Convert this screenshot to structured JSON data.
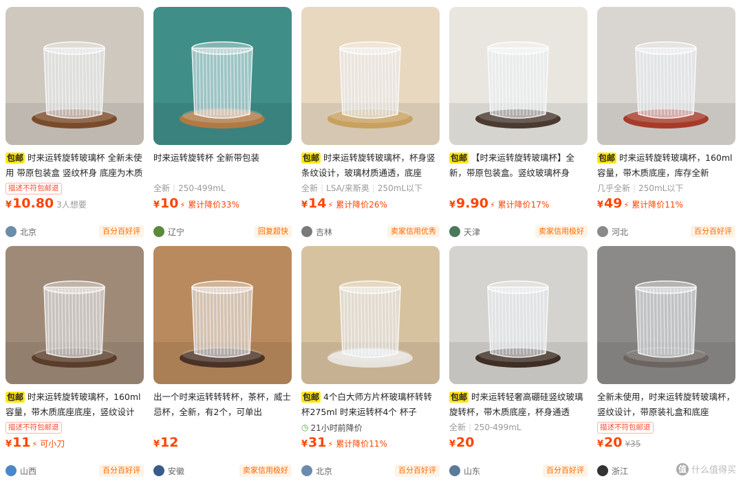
{
  "products": [
    {
      "free_shipping": "包邮",
      "title": "时来运转旋转玻璃杯 全新未使用 带原包装盒 竖纹杯身 底座为木质",
      "tag": "描述不符包邮退",
      "price": "10.80",
      "price_note": "3人想要",
      "location": "北京",
      "badge": "百分百好评",
      "bg_color": "#cfc8bf"
    },
    {
      "free_shipping": "",
      "title": "时来运转旋转杯 全新带包装",
      "meta": [
        "全新",
        "250-499mL"
      ],
      "price": "10",
      "price_note": "累计降价33%",
      "location": "辽宁",
      "badge": "回复超快",
      "bg_color": "#3f8e88"
    },
    {
      "free_shipping": "包邮",
      "title": "时来运转旋转玻璃杯，杯身竖条纹设计，玻璃材质通透，底座",
      "meta": [
        "全新",
        "LSA/来斯奥",
        "250mL以下"
      ],
      "price": "14",
      "price_note": "累计降价26%",
      "location": "吉林",
      "badge": "卖家信用优秀",
      "bg_color": "#e8d8c0"
    },
    {
      "free_shipping": "包邮",
      "title": "【时来运转旋转玻璃杯】全新，带原包装盒。竖纹玻璃杯身",
      "price": "9.90",
      "price_note": "累计降价17%",
      "location": "天津",
      "badge": "卖家信用极好",
      "bg_color": "#e9e6e0"
    },
    {
      "free_shipping": "包邮",
      "title": "时来运转旋转玻璃杯，160ml容量，带木质底座，库存全新",
      "meta": [
        "几乎全新",
        "250mL以下"
      ],
      "price": "49",
      "price_note": "累计降价11%",
      "location": "河北",
      "badge": "百分百好评",
      "bg_color": "#d9d6d2"
    },
    {
      "free_shipping": "包邮",
      "title": "时来运转旋转玻璃杯，160ml容量，带木质底座底座，竖纹设计",
      "tag": "描述不符包邮退",
      "price": "11",
      "price_note": "可小刀",
      "location": "山西",
      "badge": "百分百好评",
      "bg_color": "#9f8a78"
    },
    {
      "free_shipping": "",
      "title": "出一个时来运转转转杯，茶杯，威士忌杯，全新，有2个，可单出",
      "price": "12",
      "location": "安徽",
      "badge": "卖家信用极好",
      "bg_color": "#b98a5e"
    },
    {
      "free_shipping": "包邮",
      "title": "4个白大师方片杯玻璃杯转转杯275ml 时来运转杯4个 杯子",
      "time_tag": "21小时前降价",
      "price": "31",
      "price_note": "累计降价11%",
      "location": "北京",
      "badge": "百分百好评",
      "bg_color": "#d7c2a0"
    },
    {
      "free_shipping": "包邮",
      "title": "时来运转轻奢高硼硅竖纹玻璃旋转杯，带木质底座，杯身通透",
      "meta": [
        "全新",
        "250-499mL"
      ],
      "price": "20",
      "location": "山东",
      "badge": "百分百好评",
      "bg_color": "#d5d3cf"
    },
    {
      "free_shipping": "",
      "title": "全新未使用，时来运转旋转玻璃杯，竖纹设计，带原装礼盒和底座",
      "tag": "描述不符包邮退",
      "price": "20",
      "original_price": "¥35",
      "location": "浙江",
      "bg_color": "#8c8a88"
    }
  ],
  "currency": "¥",
  "watermark": {
    "icon": "值",
    "text": "什么值得买"
  }
}
